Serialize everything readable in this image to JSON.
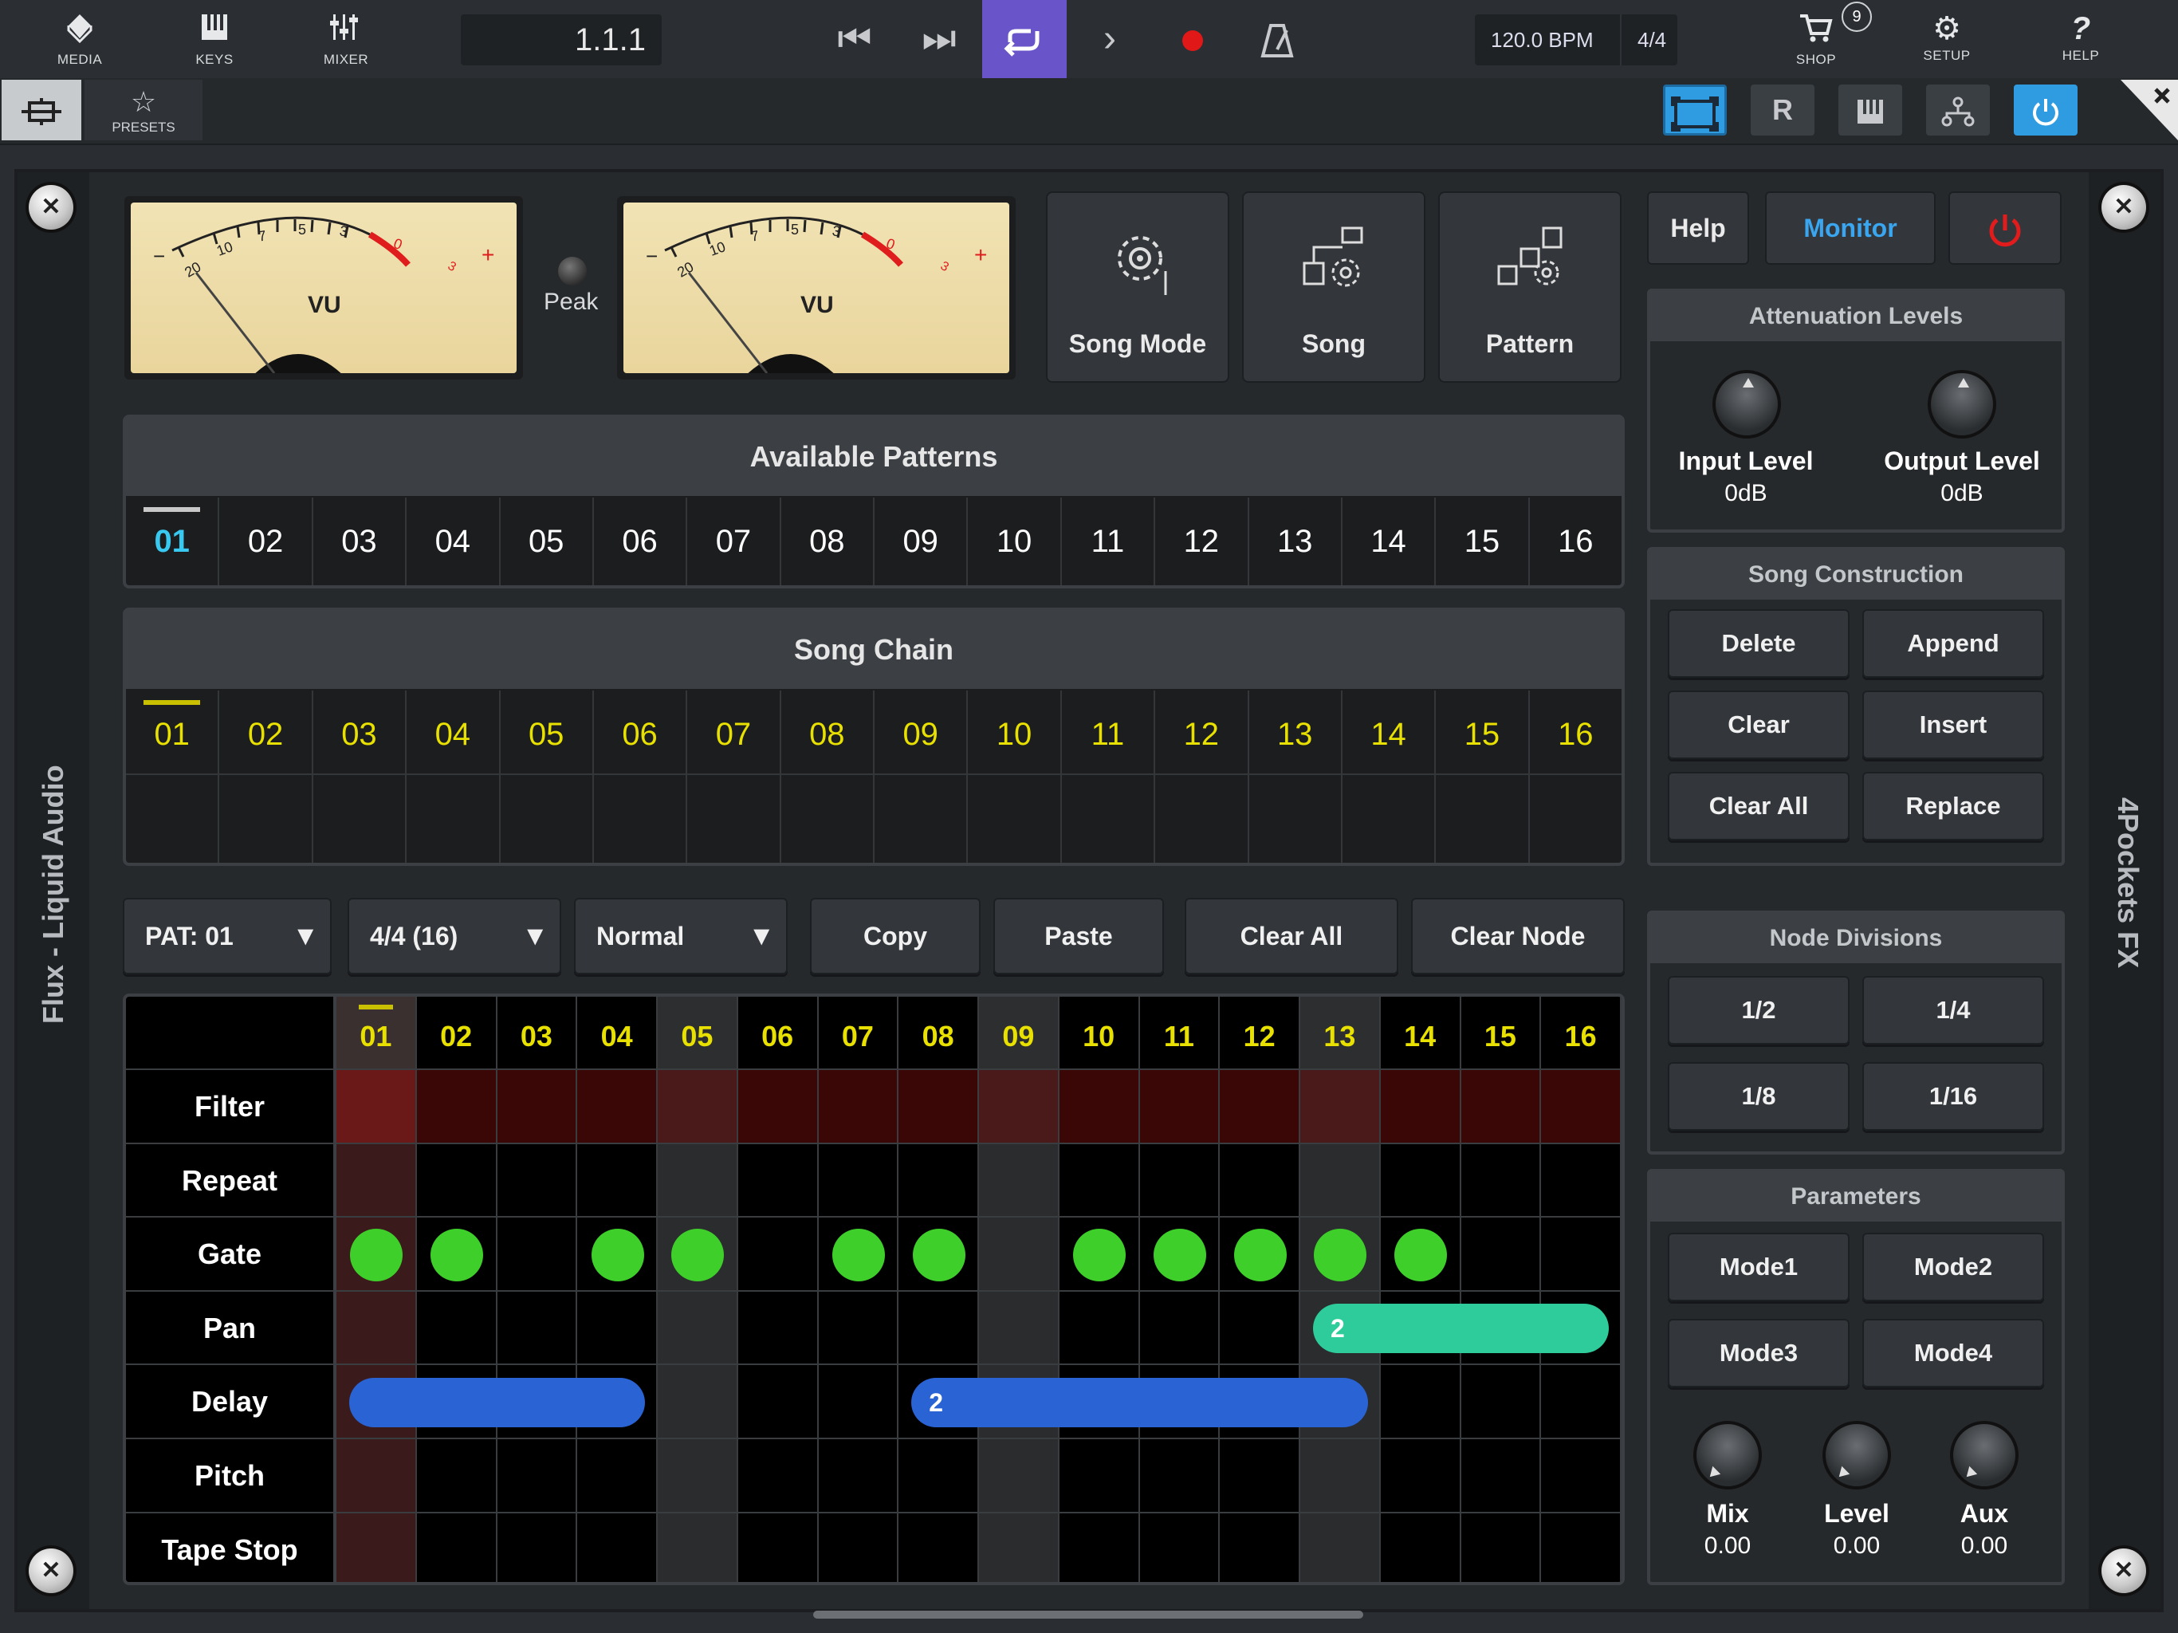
{
  "toolbar": {
    "left_buttons": [
      {
        "label": "MEDIA",
        "icon": "media-icon"
      },
      {
        "label": "KEYS",
        "icon": "keys-icon"
      },
      {
        "label": "MIXER",
        "icon": "mixer-icon"
      }
    ],
    "position": "1.1.1",
    "transport": [
      "rewind-to-start-icon",
      "skip-next-icon",
      "loop-icon",
      "play-icon",
      "record-icon",
      "metronome-icon"
    ],
    "tempo": "120.0 BPM",
    "time_signature": "4/4",
    "right_buttons": [
      {
        "label": "SHOP",
        "icon": "cart-icon",
        "badge": "9"
      },
      {
        "label": "SETUP",
        "icon": "gear-icon"
      },
      {
        "label": "HELP",
        "icon": "help-icon"
      }
    ]
  },
  "secondary_bar": {
    "presets_label": "PRESETS",
    "square_buttons": [
      "expand-icon",
      "R",
      "keyboard-icon",
      "routing-icon",
      "power-icon"
    ]
  },
  "plugin": {
    "left_rail_text": "Flux - Liquid Audio",
    "right_rail_text": "4Pockets FX",
    "meters": {
      "label": "VU",
      "scale": [
        "20",
        "10",
        "7",
        "5",
        "3",
        "0",
        "3"
      ],
      "minus": "−",
      "plus": "+",
      "peak_label": "Peak"
    },
    "mode_buttons": [
      "Song Mode",
      "Song",
      "Pattern"
    ],
    "top_right_buttons": {
      "help": "Help",
      "monitor": "Monitor"
    },
    "available_patterns": {
      "title": "Available Patterns",
      "items": [
        "01",
        "02",
        "03",
        "04",
        "05",
        "06",
        "07",
        "08",
        "09",
        "10",
        "11",
        "12",
        "13",
        "14",
        "15",
        "16"
      ],
      "selected_index": 0
    },
    "song_chain": {
      "title": "Song Chain",
      "items": [
        "01",
        "02",
        "03",
        "04",
        "05",
        "06",
        "07",
        "08",
        "09",
        "10",
        "11",
        "12",
        "13",
        "14",
        "15",
        "16"
      ]
    },
    "controls": {
      "pattern_select": "PAT: 01",
      "length_select": "4/4 (16)",
      "mode_select": "Normal",
      "copy": "Copy",
      "paste": "Paste",
      "clear_all": "Clear All",
      "clear_node": "Clear Node"
    },
    "grid": {
      "steps": [
        "01",
        "02",
        "03",
        "04",
        "05",
        "06",
        "07",
        "08",
        "09",
        "10",
        "11",
        "12",
        "13",
        "14",
        "15",
        "16"
      ],
      "rows": [
        "Filter",
        "Repeat",
        "Gate",
        "Pan",
        "Delay",
        "Pitch",
        "Tape Stop"
      ],
      "gate_on_steps": [
        1,
        2,
        4,
        5,
        7,
        8,
        10,
        11,
        12,
        13,
        14
      ],
      "pan_bar": {
        "label": "2",
        "start_step": 13,
        "end_step": 16,
        "color": "#2ecc9a"
      },
      "delay_bars": [
        {
          "label": "",
          "start_step": 1,
          "end_step": 4,
          "color": "#2a63d3"
        },
        {
          "label": "2",
          "start_step": 8,
          "end_step": 13,
          "color": "#2a63d3"
        }
      ],
      "current_step": 1
    },
    "attenuation": {
      "title": "Attenuation Levels",
      "knobs": [
        {
          "label": "Input Level",
          "value": "0dB"
        },
        {
          "label": "Output Level",
          "value": "0dB"
        }
      ]
    },
    "song_construction": {
      "title": "Song Construction",
      "buttons": [
        "Delete",
        "Append",
        "Clear",
        "Insert",
        "Clear All",
        "Replace"
      ]
    },
    "node_divisions": {
      "title": "Node Divisions",
      "buttons": [
        "1/2",
        "1/4",
        "1/8",
        "1/16"
      ]
    },
    "parameters": {
      "title": "Parameters",
      "buttons": [
        "Mode1",
        "Mode2",
        "Mode3",
        "Mode4"
      ],
      "knobs": [
        {
          "label": "Mix",
          "value": "0.00"
        },
        {
          "label": "Level",
          "value": "0.00"
        },
        {
          "label": "Aux",
          "value": "0.00"
        }
      ]
    }
  },
  "colors": {
    "accent_loop": "#6a54c9",
    "accent_blue": "#2f9be0",
    "selected_pattern": "#38c8f0",
    "song_chain_text": "#e8e000",
    "gate_dot": "#3ecf2a",
    "filter_row": "#3a0606"
  }
}
